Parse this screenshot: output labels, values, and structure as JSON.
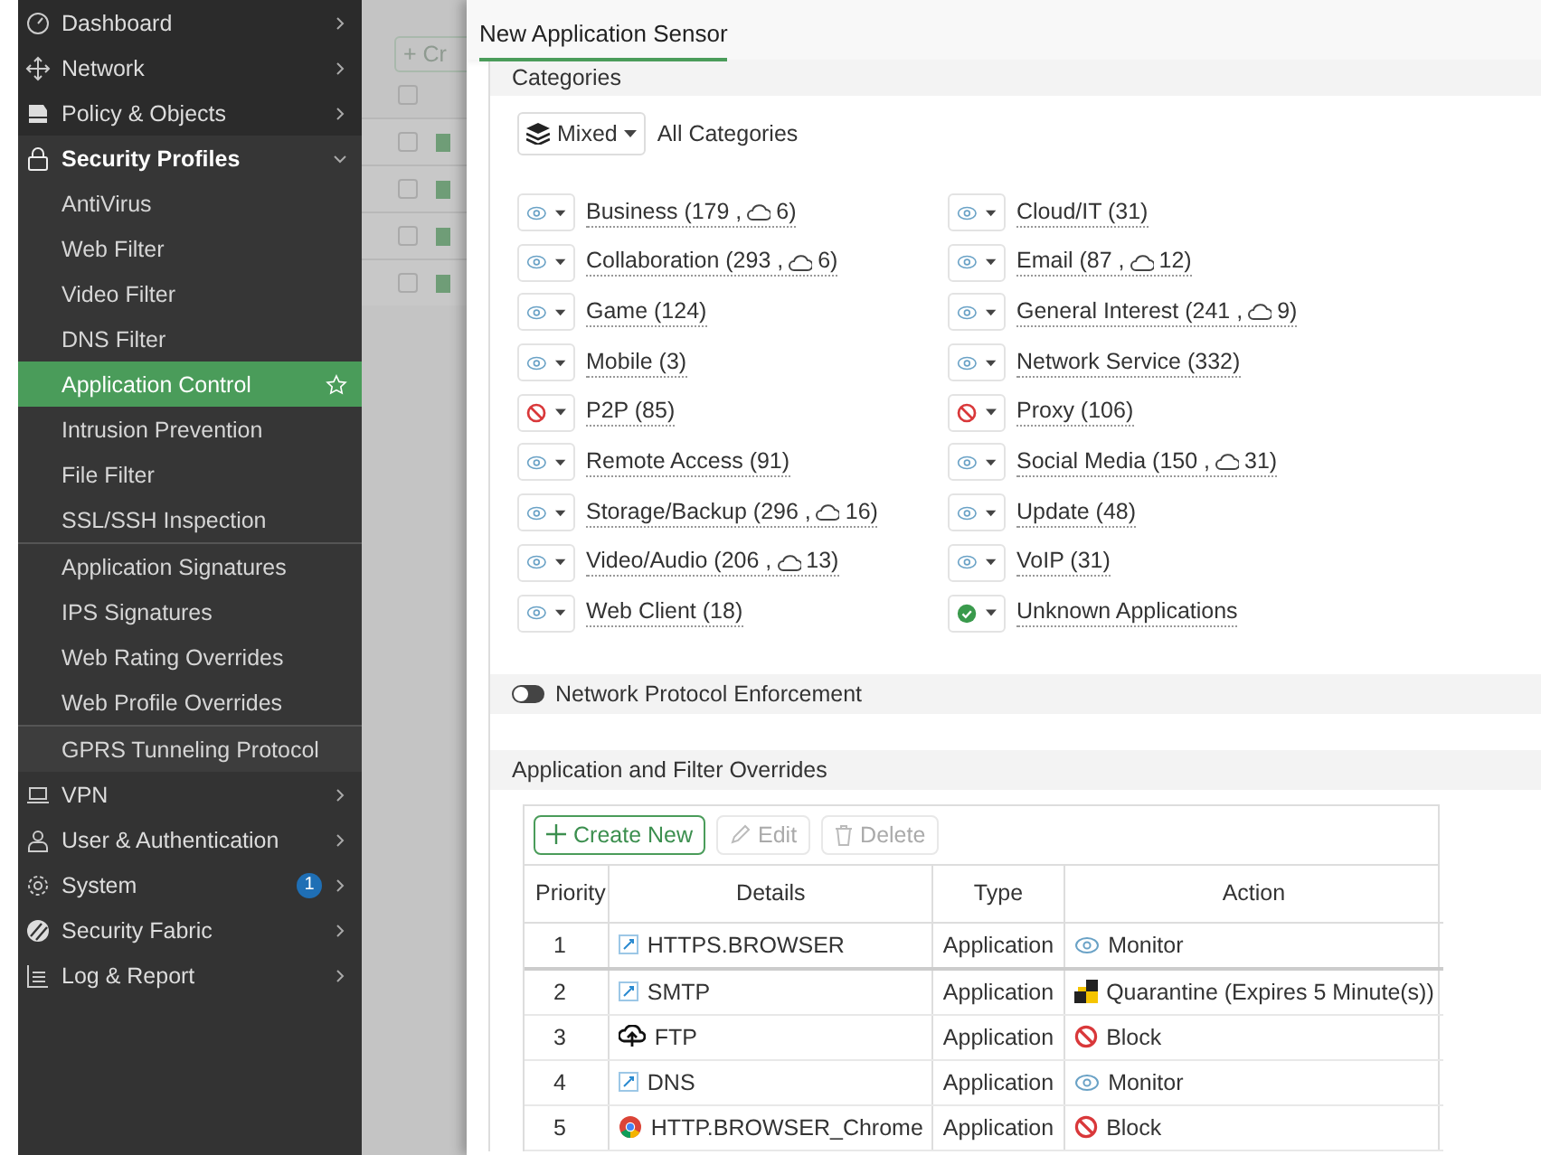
{
  "sidebar": {
    "items": [
      {
        "kind": "top",
        "label": "Dashboard",
        "expanded": false
      },
      {
        "kind": "top",
        "label": "Network",
        "expanded": false
      },
      {
        "kind": "top",
        "label": "Policy & Objects",
        "expanded": false
      },
      {
        "kind": "top",
        "label": "Security Profiles",
        "expanded": true,
        "groups": [
          [
            {
              "label": "AntiVirus",
              "selected": false
            },
            {
              "label": "Web Filter",
              "selected": false
            },
            {
              "label": "Video Filter",
              "selected": false
            },
            {
              "label": "DNS Filter",
              "selected": false
            },
            {
              "label": "Application Control",
              "selected": true
            },
            {
              "label": "Intrusion Prevention",
              "selected": false
            },
            {
              "label": "File Filter",
              "selected": false
            },
            {
              "label": "SSL/SSH Inspection",
              "selected": false
            }
          ],
          [
            {
              "label": "Application Signatures",
              "selected": false
            },
            {
              "label": "IPS Signatures",
              "selected": false
            },
            {
              "label": "Web Rating Overrides",
              "selected": false
            },
            {
              "label": "Web Profile Overrides",
              "selected": false
            }
          ],
          [
            {
              "label": "GPRS Tunneling Protocol",
              "selected": false
            }
          ]
        ]
      },
      {
        "kind": "top",
        "label": "VPN",
        "expanded": false
      },
      {
        "kind": "top",
        "label": "User & Authentication",
        "expanded": false
      },
      {
        "kind": "top",
        "label": "System",
        "expanded": false,
        "badge": "1"
      },
      {
        "kind": "top",
        "label": "Security Fabric",
        "expanded": false
      },
      {
        "kind": "top",
        "label": "Log & Report",
        "expanded": false
      }
    ]
  },
  "background_page": {
    "button": "+ Cr",
    "header_checked": false,
    "rows": [
      {
        "checked": false
      },
      {
        "checked": false
      },
      {
        "checked": false
      },
      {
        "checked": false
      }
    ]
  },
  "panel": {
    "title": "New Application Sensor",
    "categories": {
      "title": "Categories",
      "mode_button": "Mixed",
      "mode_label": "All Categories",
      "items": [
        {
          "kind": "monitor",
          "label": "Business (179 ,",
          "cloud_count": "6)"
        },
        {
          "kind": "monitor",
          "label": "Cloud/IT (31)"
        },
        {
          "kind": "monitor",
          "label": "Collaboration (293 ,",
          "cloud_count": "6)"
        },
        {
          "kind": "monitor",
          "label": "Email (87 ,",
          "cloud_count": "12)"
        },
        {
          "kind": "monitor",
          "label": "Game (124)"
        },
        {
          "kind": "monitor",
          "label": "General Interest (241 ,",
          "cloud_count": "9)"
        },
        {
          "kind": "monitor",
          "label": "Mobile (3)"
        },
        {
          "kind": "monitor",
          "label": "Network Service (332)"
        },
        {
          "kind": "block",
          "label": "P2P (85)"
        },
        {
          "kind": "block",
          "label": "Proxy (106)"
        },
        {
          "kind": "monitor",
          "label": "Remote Access (91)"
        },
        {
          "kind": "monitor",
          "label": "Social Media (150 ,",
          "cloud_count": "31)"
        },
        {
          "kind": "monitor",
          "label": "Storage/Backup (296 ,",
          "cloud_count": "16)"
        },
        {
          "kind": "monitor",
          "label": "Update (48)"
        },
        {
          "kind": "monitor",
          "label": "Video/Audio (206 ,",
          "cloud_count": "13)"
        },
        {
          "kind": "monitor",
          "label": "VoIP (31)"
        },
        {
          "kind": "monitor",
          "label": "Web Client (18)"
        },
        {
          "kind": "allow",
          "label": "Unknown Applications"
        }
      ]
    },
    "protocol_enforcement": {
      "label": "Network Protocol Enforcement",
      "on": false
    },
    "overrides": {
      "title": "Application and Filter Overrides",
      "buttons": [
        {
          "kind": "create",
          "label": "Create New",
          "disabled": false
        },
        {
          "kind": "edit",
          "label": "Edit",
          "disabled": true
        },
        {
          "kind": "delete",
          "label": "Delete",
          "disabled": true
        }
      ],
      "columns": [
        "Priority",
        "Details",
        "Type",
        "Action"
      ],
      "rows": [
        {
          "priority": "1",
          "kind": "app",
          "details": "HTTPS.BROWSER",
          "type": "Application",
          "action": {
            "kind": "monitor",
            "label": "Monitor"
          }
        },
        {
          "priority": "2",
          "kind": "app",
          "details": "SMTP",
          "type": "Application",
          "action": {
            "kind": "quarantine",
            "label": "Quarantine (Expires 5 Minute(s))"
          }
        },
        {
          "priority": "3",
          "kind": "ftp",
          "details": "FTP",
          "type": "Application",
          "action": {
            "kind": "block",
            "label": "Block"
          }
        },
        {
          "priority": "4",
          "kind": "app",
          "details": "DNS",
          "type": "Application",
          "action": {
            "kind": "monitor",
            "label": "Monitor"
          }
        },
        {
          "priority": "5",
          "kind": "chrome",
          "details": "HTTP.BROWSER_Chrome",
          "type": "Application",
          "action": {
            "kind": "block",
            "label": "Block"
          }
        }
      ]
    }
  }
}
